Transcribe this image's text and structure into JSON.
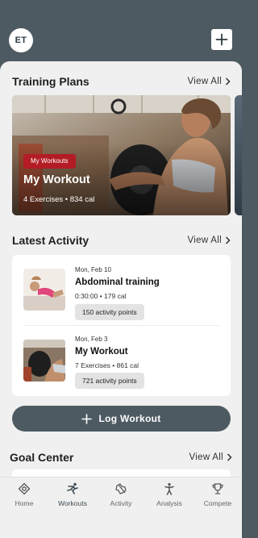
{
  "header": {
    "avatar_initials": "ET"
  },
  "training_plans": {
    "title": "Training Plans",
    "view_all": "View All",
    "cards": [
      {
        "badge": "My Workouts",
        "title": "My Workout",
        "meta": "4 Exercises • 834 cal"
      }
    ]
  },
  "latest_activity": {
    "title": "Latest Activity",
    "view_all": "View All",
    "items": [
      {
        "date": "Mon, Feb 10",
        "title": "Abdominal training",
        "meta": "0:30:00 • 179 cal",
        "points": "150 activity points"
      },
      {
        "date": "Mon, Feb 3",
        "title": "My Workout",
        "meta": "7 Exercises • 861 cal",
        "points": "721 activity points"
      }
    ]
  },
  "log_button": {
    "label": "Log Workout"
  },
  "goal_center": {
    "title": "Goal Center",
    "view_all": "View All"
  },
  "nav": {
    "items": [
      {
        "label": "Home",
        "icon": "home-icon"
      },
      {
        "label": "Workouts",
        "icon": "workouts-icon"
      },
      {
        "label": "Activity",
        "icon": "activity-icon"
      },
      {
        "label": "Analysis",
        "icon": "analysis-icon"
      },
      {
        "label": "Compete",
        "icon": "trophy-icon"
      }
    ],
    "active": "Workouts"
  },
  "colors": {
    "header": "#4e5a62",
    "badge": "#b31c24",
    "background": "#f0f0f0"
  }
}
